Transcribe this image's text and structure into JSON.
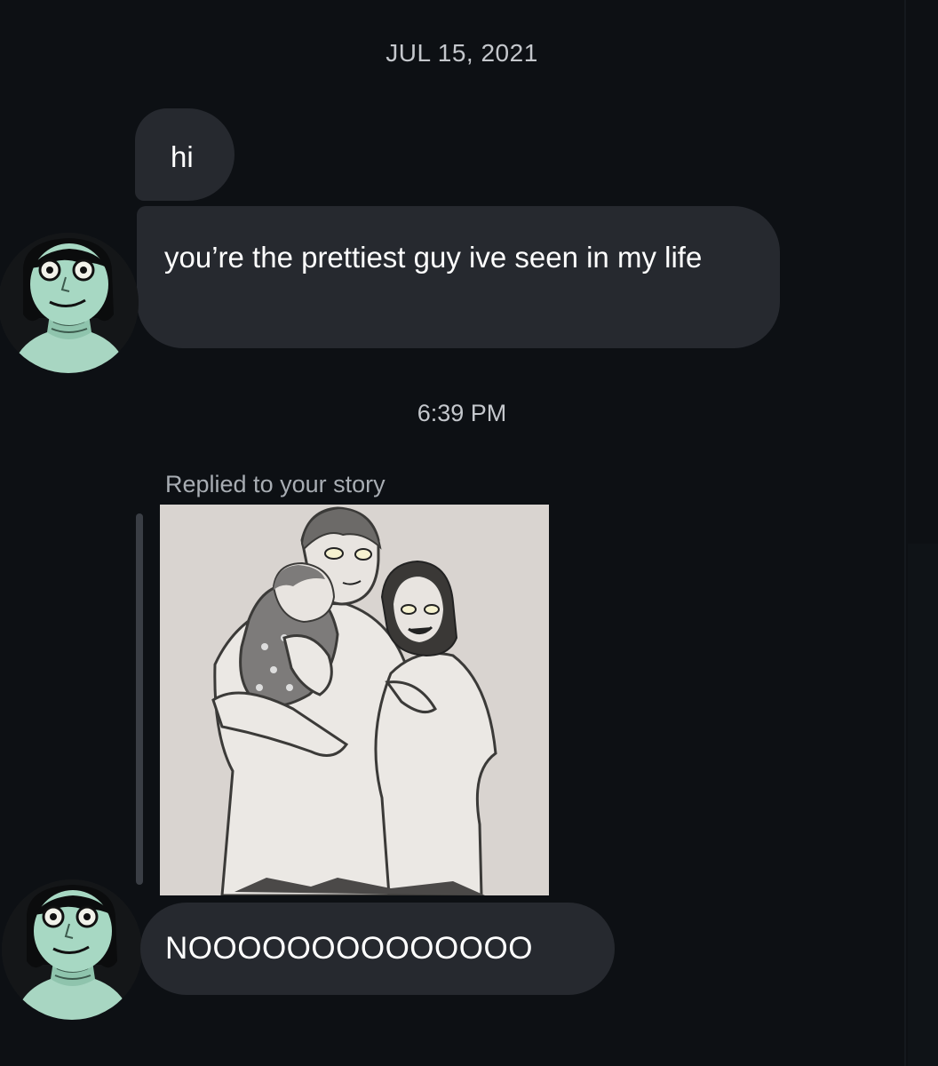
{
  "thread": {
    "date_label": "JUL 15, 2021",
    "time_label": "6:39 PM",
    "messages": [
      {
        "text": "hi"
      },
      {
        "text": "you’re the prettiest guy ive seen in my life"
      },
      {
        "text": "NOOOOOOOOOOOOOO"
      }
    ],
    "story_reply": {
      "label": "Replied to your story"
    }
  },
  "colors": {
    "background": "#0d1014",
    "bubble": "#26292f",
    "meta_text": "#c4c7cc"
  },
  "icons": {
    "avatar": "illustrated-person-avatar",
    "story": "illustrated-family-image"
  }
}
